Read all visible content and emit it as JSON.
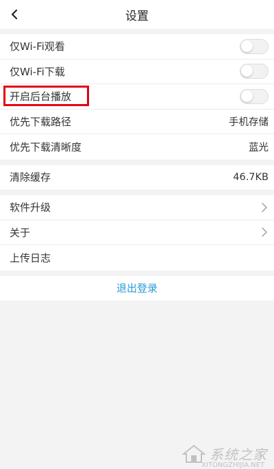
{
  "header": {
    "title": "设置"
  },
  "playback": [
    {
      "label": "仅Wi-Fi观看",
      "type": "toggle",
      "on": false
    },
    {
      "label": "仅Wi-Fi下载",
      "type": "toggle",
      "on": false
    },
    {
      "label": "开启后台播放",
      "type": "toggle",
      "on": false
    },
    {
      "label": "优先下载路径",
      "type": "value",
      "value": "手机存储"
    },
    {
      "label": "优先下载清晰度",
      "type": "value",
      "value": "蓝光"
    }
  ],
  "cache": {
    "label": "清除缓存",
    "value": "46.7KB"
  },
  "about": [
    {
      "label": "软件升级",
      "type": "chevron"
    },
    {
      "label": "关于",
      "type": "chevron"
    },
    {
      "label": "上传日志",
      "type": "none"
    }
  ],
  "logout": {
    "label": "退出登录"
  },
  "watermark": {
    "text": "系统之家",
    "url": "XITONGZHIJIA.NET"
  },
  "colors": {
    "highlight": "#e30010",
    "link": "#2a9ad8",
    "background": "#f3f3f3"
  }
}
